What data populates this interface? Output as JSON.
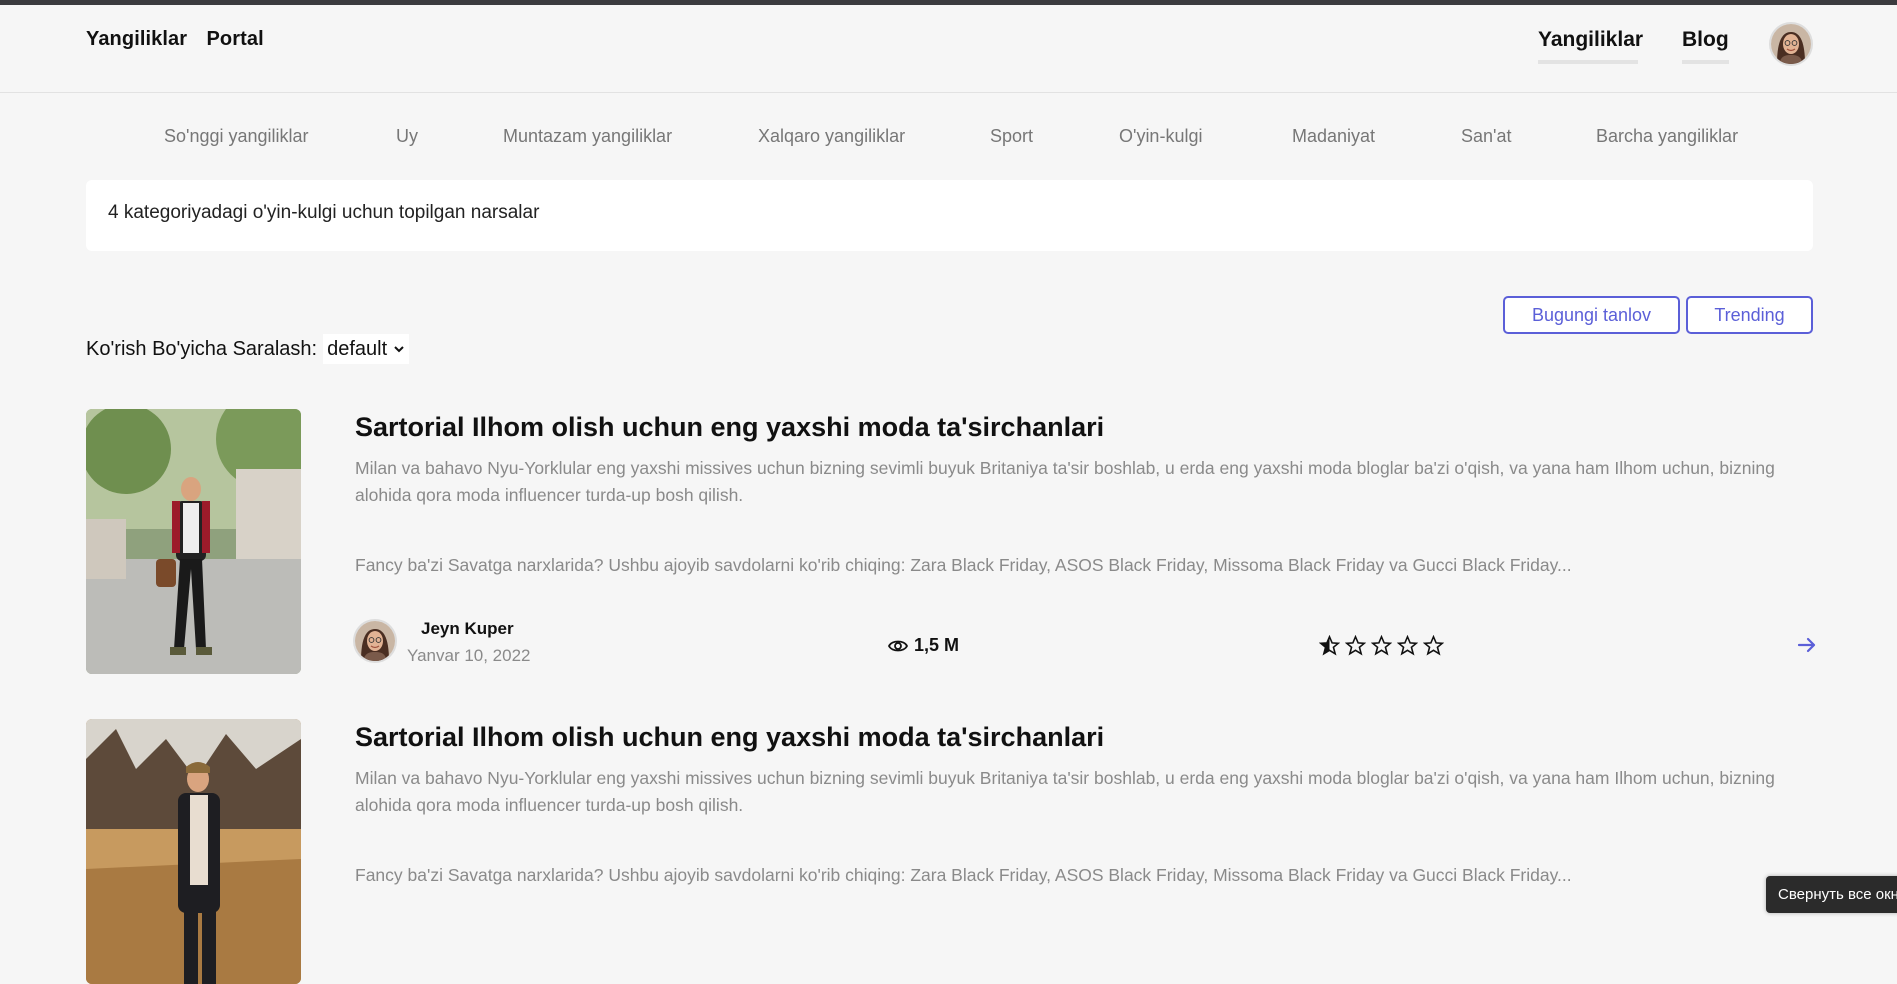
{
  "header": {
    "logo": "Yangiliklar  Portal",
    "nav": [
      {
        "label": "Yangiliklar"
      },
      {
        "label": "Blog"
      }
    ]
  },
  "categories": [
    "So'nggi yangiliklar",
    "Uy",
    "Muntazam yangiliklar",
    "Xalqaro yangiliklar",
    "Sport",
    "O'yin-kulgi",
    "Madaniyat",
    "San'at",
    "Barcha yangiliklar"
  ],
  "result": {
    "text": "4 kategoriyadagi o'yin-kulgi uchun topilgan narsalar"
  },
  "tabs": {
    "today": "Bugungi tanlov",
    "trending": "Trending"
  },
  "sort": {
    "label": "Ko'rish Bo'yicha Saralash:",
    "value": "default"
  },
  "articles": [
    {
      "title": "Sartorial Ilhom olish uchun eng yaxshi moda ta'sirchanlari",
      "description": "Milan va bahavo Nyu-Yorklular eng yaxshi missives uchun bizning sevimli buyuk Britaniya ta'sir boshlab, u erda eng yaxshi moda bloglar ba'zi o'qish, va yana ham Ilhom uchun, bizning alohida qora moda influencer turda-up bosh qilish.",
      "teaser": "Fancy ba'zi Savatga narxlarida? Ushbu ajoyib savdolarni ko'rib chiqing: Zara Black Friday, ASOS Black Friday, Missoma Black Friday va Gucci Black Friday...",
      "author": "Jeyn Kuper",
      "date": "Yanvar 10, 2022",
      "views": "1,5 M",
      "rating": 0.5,
      "rating_max": 5
    },
    {
      "title": "Sartorial Ilhom olish uchun eng yaxshi moda ta'sirchanlari",
      "description": "Milan va bahavo Nyu-Yorklular eng yaxshi missives uchun bizning sevimli buyuk Britaniya ta'sir boshlab, u erda eng yaxshi moda bloglar ba'zi o'qish, va yana ham Ilhom uchun, bizning alohida qora moda influencer turda-up bosh qilish.",
      "teaser": "Fancy ba'zi Savatga narxlarida? Ushbu ajoyib savdolarni ko'rib chiqing: Zara Black Friday, ASOS Black Friday, Missoma Black Friday va Gucci Black Friday..."
    }
  ],
  "toast": {
    "text": "Свернуть все окна"
  },
  "colors": {
    "accent": "#5b5fd8",
    "muted_text": "#8a8a8a",
    "background": "#f6f6f6"
  }
}
